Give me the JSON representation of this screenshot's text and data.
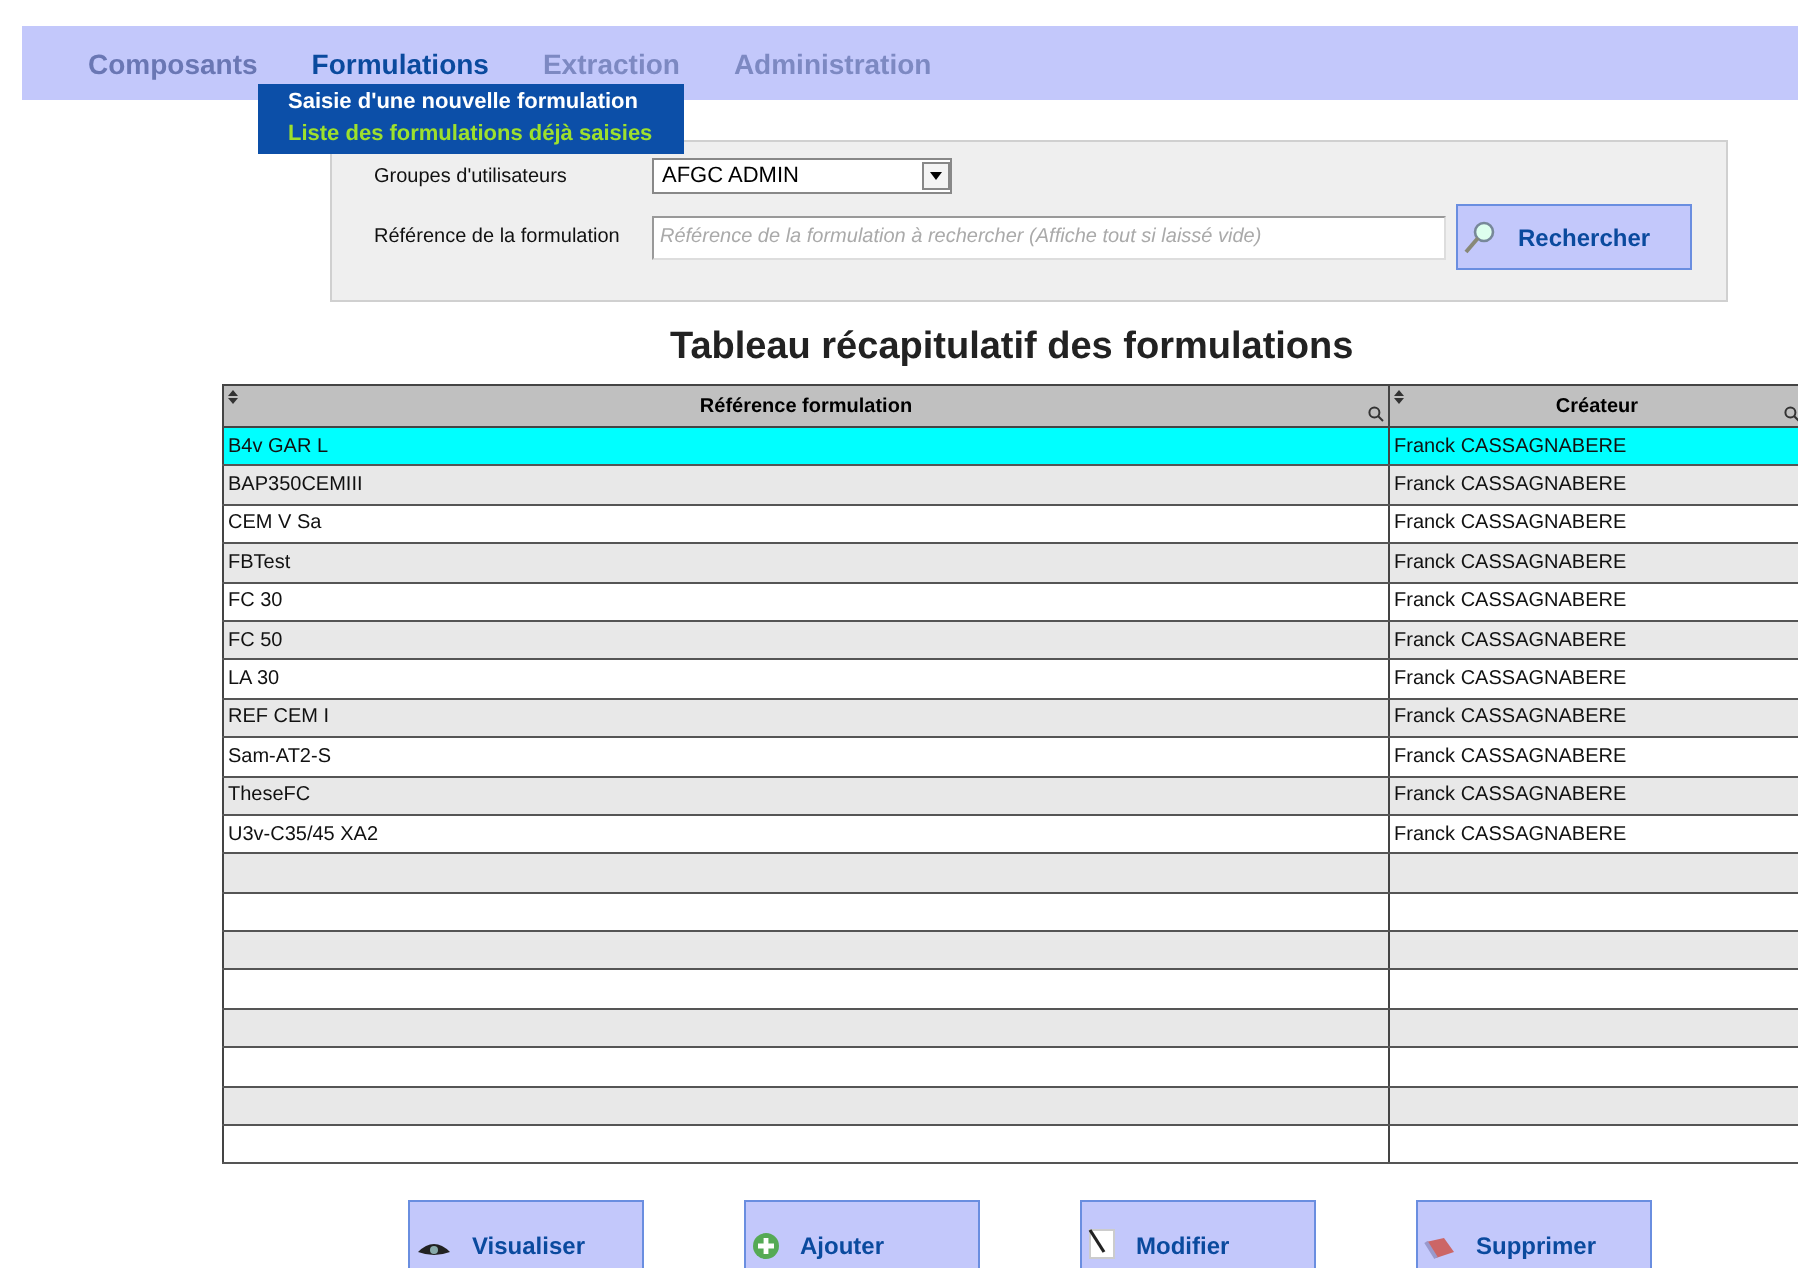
{
  "menu": [
    {
      "label": "Composants",
      "selected": false,
      "disabled": false
    },
    {
      "label": "Formulations",
      "selected": true,
      "disabled": false
    },
    {
      "label": "Extraction",
      "selected": false,
      "disabled": true
    },
    {
      "label": "Administration",
      "selected": false,
      "disabled": true
    }
  ],
  "submenu": [
    {
      "label": "Saisie d'une nouvelle formulation",
      "selected": false
    },
    {
      "label": "Liste des formulations déjà saisies",
      "selected": true
    }
  ],
  "search": {
    "group_label": "Groupes d'utilisateurs",
    "group_value": "AFGC ADMIN",
    "reference_label": "Référence de la formulation",
    "reference_placeholder": "Référence de la formulation à rechercher (Affiche tout si laissé vide)",
    "button": "Rechercher"
  },
  "title": "Tableau récapitulatif des formulations",
  "table": {
    "columns": [
      "Référence formulation",
      "Créateur"
    ],
    "rows": [
      {
        "cells": [
          "B4v GAR L",
          "Franck CASSAGNABERE"
        ],
        "selected": true
      },
      {
        "cells": [
          "BAP350CEMIII",
          "Franck CASSAGNABERE"
        ],
        "selected": false
      },
      {
        "cells": [
          "CEM V Sa",
          "Franck CASSAGNABERE"
        ],
        "selected": false
      },
      {
        "cells": [
          "FBTest",
          "Franck CASSAGNABERE"
        ],
        "selected": false
      },
      {
        "cells": [
          "FC 30",
          "Franck CASSAGNABERE"
        ],
        "selected": false
      },
      {
        "cells": [
          "FC 50",
          "Franck CASSAGNABERE"
        ],
        "selected": false
      },
      {
        "cells": [
          "LA 30",
          "Franck CASSAGNABERE"
        ],
        "selected": false
      },
      {
        "cells": [
          "REF CEM I",
          "Franck CASSAGNABERE"
        ],
        "selected": false
      },
      {
        "cells": [
          "Sam-AT2-S",
          "Franck CASSAGNABERE"
        ],
        "selected": false
      },
      {
        "cells": [
          "TheseFC",
          "Franck CASSAGNABERE"
        ],
        "selected": false
      },
      {
        "cells": [
          "U3v-C35/45 XA2",
          "Franck CASSAGNABERE"
        ],
        "selected": false
      }
    ]
  },
  "actions": [
    {
      "label": "Visualiser",
      "kind": "view"
    },
    {
      "label": "Ajouter",
      "kind": "add"
    },
    {
      "label": "Modifier",
      "kind": "edit"
    },
    {
      "label": "Supprimer",
      "kind": "delete"
    }
  ]
}
